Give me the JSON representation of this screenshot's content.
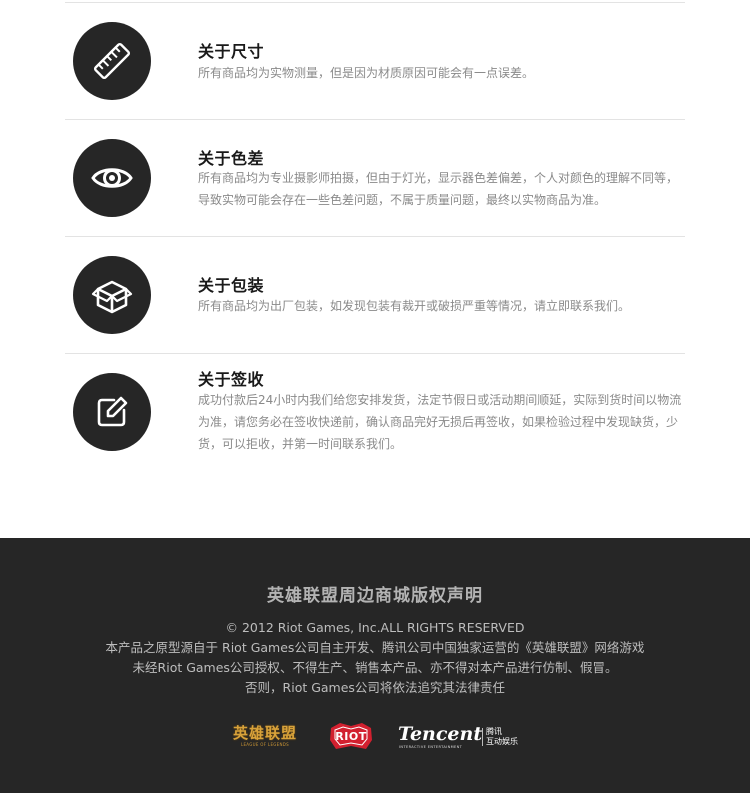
{
  "sections": [
    {
      "icon": "ruler-icon",
      "title": "关于尺寸",
      "desc": "所有商品均为实物测量，但是因为材质原因可能会有一点误差。"
    },
    {
      "icon": "eye-icon",
      "title": "关于色差",
      "desc": "所有商品均为专业摄影师拍摄，但由于灯光，显示器色差偏差，个人对颜色的理解不同等，导致实物可能会存在一些色差问题，不属于质量问题，最终以实物商品为准。"
    },
    {
      "icon": "package-box-icon",
      "title": "关于包装",
      "desc": "所有商品均为出厂包装，如发现包装有裁开或破损严重等情况，请立即联系我们。"
    },
    {
      "icon": "edit-note-icon",
      "title": "关于签收",
      "desc": "成功付款后24小时内我们给您安排发货，法定节假日或活动期间顺延，实际到货时间以物流为准，请您务必在签收快递前，确认商品完好无损后再签收，如果检验过程中发现缺货，少货，可以拒收，并第一时间联系我们。"
    }
  ],
  "footer": {
    "title": "英雄联盟周边商城版权声明",
    "copyright": "© 2012 Riot Games, Inc.ALL RIGHTS RESERVED",
    "line1": "本产品之原型源自于 Riot Games公司自主开发、腾讯公司中国独家运营的《英雄联盟》网络游戏",
    "line2": "未经Riot Games公司授权、不得生产、销售本产品、亦不得对本产品进行仿制、假冒。",
    "line3": "否则，Riot Games公司将依法追究其法律责任",
    "logos": {
      "lol_text": "英雄联盟",
      "lol_sub": "LEAGUE OF LEGENDS",
      "riot_text": "RIOT",
      "tencent_text": "Tencent",
      "tencent_sub": "INTERACTIVE ENTERTAINMENT",
      "tencent_cn1": "腾讯",
      "tencent_cn2": "互动娱乐"
    }
  },
  "colors": {
    "circle": "#262626",
    "footer_bg": "#262626",
    "lol_gold": "#d8a23a",
    "riot_red": "#d2202f"
  }
}
